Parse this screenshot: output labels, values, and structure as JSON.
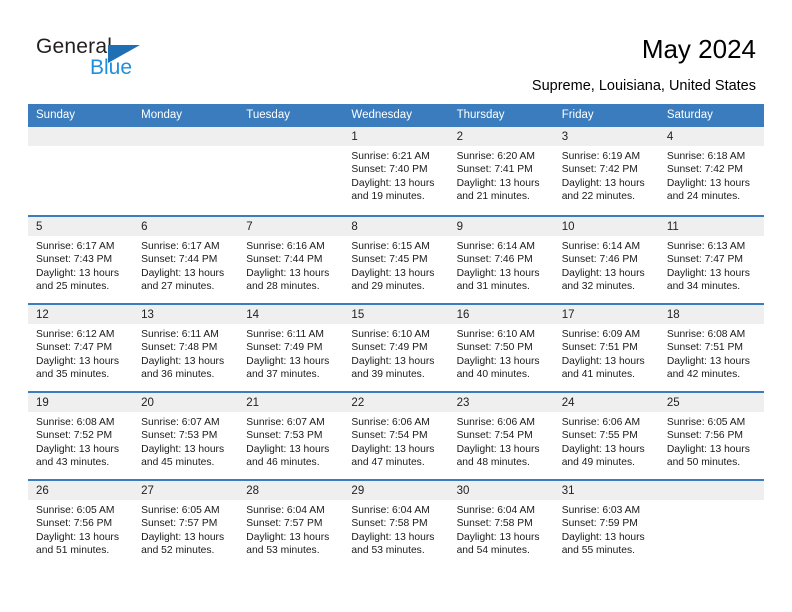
{
  "brand": {
    "name_primary": "General",
    "name_secondary": "Blue",
    "triangle_icon": "blue-triangle-logo-icon",
    "primary_color": "#231f20",
    "secondary_color": "#1f8fdd",
    "triangle_color": "#1f6fb5"
  },
  "header": {
    "title": "May 2024",
    "subtitle": "Supreme, Louisiana, United States"
  },
  "theme": {
    "header_bar_color": "#3a7cbd",
    "day_band_color": "#efefef",
    "text_color": "#1a1a1a"
  },
  "calendar": {
    "weekdays": [
      "Sunday",
      "Monday",
      "Tuesday",
      "Wednesday",
      "Thursday",
      "Friday",
      "Saturday"
    ],
    "weeks": [
      [
        {
          "day": "",
          "empty": true
        },
        {
          "day": "",
          "empty": true
        },
        {
          "day": "",
          "empty": true
        },
        {
          "day": "1",
          "sunrise": "Sunrise: 6:21 AM",
          "sunset": "Sunset: 7:40 PM",
          "daylight": "Daylight: 13 hours and 19 minutes."
        },
        {
          "day": "2",
          "sunrise": "Sunrise: 6:20 AM",
          "sunset": "Sunset: 7:41 PM",
          "daylight": "Daylight: 13 hours and 21 minutes."
        },
        {
          "day": "3",
          "sunrise": "Sunrise: 6:19 AM",
          "sunset": "Sunset: 7:42 PM",
          "daylight": "Daylight: 13 hours and 22 minutes."
        },
        {
          "day": "4",
          "sunrise": "Sunrise: 6:18 AM",
          "sunset": "Sunset: 7:42 PM",
          "daylight": "Daylight: 13 hours and 24 minutes."
        }
      ],
      [
        {
          "day": "5",
          "sunrise": "Sunrise: 6:17 AM",
          "sunset": "Sunset: 7:43 PM",
          "daylight": "Daylight: 13 hours and 25 minutes."
        },
        {
          "day": "6",
          "sunrise": "Sunrise: 6:17 AM",
          "sunset": "Sunset: 7:44 PM",
          "daylight": "Daylight: 13 hours and 27 minutes."
        },
        {
          "day": "7",
          "sunrise": "Sunrise: 6:16 AM",
          "sunset": "Sunset: 7:44 PM",
          "daylight": "Daylight: 13 hours and 28 minutes."
        },
        {
          "day": "8",
          "sunrise": "Sunrise: 6:15 AM",
          "sunset": "Sunset: 7:45 PM",
          "daylight": "Daylight: 13 hours and 29 minutes."
        },
        {
          "day": "9",
          "sunrise": "Sunrise: 6:14 AM",
          "sunset": "Sunset: 7:46 PM",
          "daylight": "Daylight: 13 hours and 31 minutes."
        },
        {
          "day": "10",
          "sunrise": "Sunrise: 6:14 AM",
          "sunset": "Sunset: 7:46 PM",
          "daylight": "Daylight: 13 hours and 32 minutes."
        },
        {
          "day": "11",
          "sunrise": "Sunrise: 6:13 AM",
          "sunset": "Sunset: 7:47 PM",
          "daylight": "Daylight: 13 hours and 34 minutes."
        }
      ],
      [
        {
          "day": "12",
          "sunrise": "Sunrise: 6:12 AM",
          "sunset": "Sunset: 7:47 PM",
          "daylight": "Daylight: 13 hours and 35 minutes."
        },
        {
          "day": "13",
          "sunrise": "Sunrise: 6:11 AM",
          "sunset": "Sunset: 7:48 PM",
          "daylight": "Daylight: 13 hours and 36 minutes."
        },
        {
          "day": "14",
          "sunrise": "Sunrise: 6:11 AM",
          "sunset": "Sunset: 7:49 PM",
          "daylight": "Daylight: 13 hours and 37 minutes."
        },
        {
          "day": "15",
          "sunrise": "Sunrise: 6:10 AM",
          "sunset": "Sunset: 7:49 PM",
          "daylight": "Daylight: 13 hours and 39 minutes."
        },
        {
          "day": "16",
          "sunrise": "Sunrise: 6:10 AM",
          "sunset": "Sunset: 7:50 PM",
          "daylight": "Daylight: 13 hours and 40 minutes."
        },
        {
          "day": "17",
          "sunrise": "Sunrise: 6:09 AM",
          "sunset": "Sunset: 7:51 PM",
          "daylight": "Daylight: 13 hours and 41 minutes."
        },
        {
          "day": "18",
          "sunrise": "Sunrise: 6:08 AM",
          "sunset": "Sunset: 7:51 PM",
          "daylight": "Daylight: 13 hours and 42 minutes."
        }
      ],
      [
        {
          "day": "19",
          "sunrise": "Sunrise: 6:08 AM",
          "sunset": "Sunset: 7:52 PM",
          "daylight": "Daylight: 13 hours and 43 minutes."
        },
        {
          "day": "20",
          "sunrise": "Sunrise: 6:07 AM",
          "sunset": "Sunset: 7:53 PM",
          "daylight": "Daylight: 13 hours and 45 minutes."
        },
        {
          "day": "21",
          "sunrise": "Sunrise: 6:07 AM",
          "sunset": "Sunset: 7:53 PM",
          "daylight": "Daylight: 13 hours and 46 minutes."
        },
        {
          "day": "22",
          "sunrise": "Sunrise: 6:06 AM",
          "sunset": "Sunset: 7:54 PM",
          "daylight": "Daylight: 13 hours and 47 minutes."
        },
        {
          "day": "23",
          "sunrise": "Sunrise: 6:06 AM",
          "sunset": "Sunset: 7:54 PM",
          "daylight": "Daylight: 13 hours and 48 minutes."
        },
        {
          "day": "24",
          "sunrise": "Sunrise: 6:06 AM",
          "sunset": "Sunset: 7:55 PM",
          "daylight": "Daylight: 13 hours and 49 minutes."
        },
        {
          "day": "25",
          "sunrise": "Sunrise: 6:05 AM",
          "sunset": "Sunset: 7:56 PM",
          "daylight": "Daylight: 13 hours and 50 minutes."
        }
      ],
      [
        {
          "day": "26",
          "sunrise": "Sunrise: 6:05 AM",
          "sunset": "Sunset: 7:56 PM",
          "daylight": "Daylight: 13 hours and 51 minutes."
        },
        {
          "day": "27",
          "sunrise": "Sunrise: 6:05 AM",
          "sunset": "Sunset: 7:57 PM",
          "daylight": "Daylight: 13 hours and 52 minutes."
        },
        {
          "day": "28",
          "sunrise": "Sunrise: 6:04 AM",
          "sunset": "Sunset: 7:57 PM",
          "daylight": "Daylight: 13 hours and 53 minutes."
        },
        {
          "day": "29",
          "sunrise": "Sunrise: 6:04 AM",
          "sunset": "Sunset: 7:58 PM",
          "daylight": "Daylight: 13 hours and 53 minutes."
        },
        {
          "day": "30",
          "sunrise": "Sunrise: 6:04 AM",
          "sunset": "Sunset: 7:58 PM",
          "daylight": "Daylight: 13 hours and 54 minutes."
        },
        {
          "day": "31",
          "sunrise": "Sunrise: 6:03 AM",
          "sunset": "Sunset: 7:59 PM",
          "daylight": "Daylight: 13 hours and 55 minutes."
        },
        {
          "day": "",
          "empty": true
        }
      ]
    ]
  }
}
